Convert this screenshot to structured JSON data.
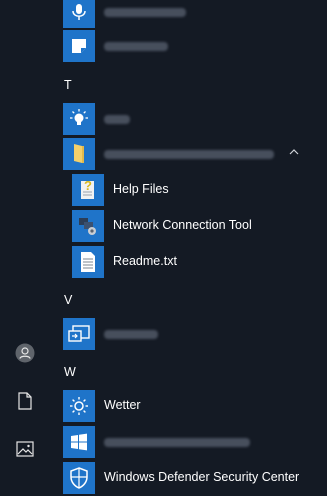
{
  "rail": {
    "user_icon": "user-icon",
    "documents_icon": "document-icon",
    "pictures_icon": "picture-icon"
  },
  "sections": {
    "t": "T",
    "v": "V",
    "w": "W"
  },
  "apps": {
    "help_files": "Help Files",
    "network_tool": "Network Connection Tool",
    "readme": "Readme.txt",
    "wetter": "Wetter",
    "defender": "Windows Defender Security Center"
  },
  "colors": {
    "background": "#141a24",
    "tile_blue": "#1f74c9"
  }
}
